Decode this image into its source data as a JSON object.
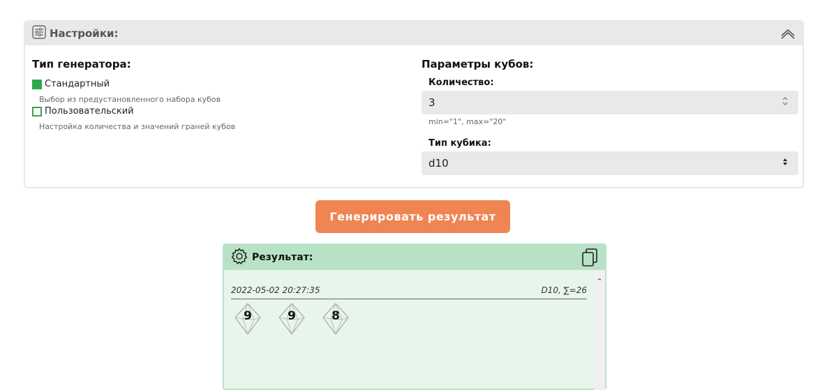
{
  "settings": {
    "title": "Настройки:",
    "generator_type": {
      "heading": "Тип генератора:",
      "options": [
        {
          "label": "Стандартный",
          "description": "Выбор из предустановленного набора кубов",
          "checked": true
        },
        {
          "label": "Пользовательский",
          "description": "Настройка количества и значений граней кубов",
          "checked": false
        }
      ]
    },
    "dice_params": {
      "heading": "Параметры кубов:",
      "count_label": "Количество:",
      "count_value": "3",
      "count_hint": "min=\"1\", max=\"20\"",
      "type_label": "Тип кубика:",
      "type_value": "d10"
    }
  },
  "generate_button": "Генерировать результат",
  "result": {
    "title": "Результат:",
    "timestamp": "2022-05-02 20:27:35",
    "summary": "D10, ∑=26",
    "dice": [
      "9",
      "9",
      "8"
    ]
  },
  "colors": {
    "accent_green": "#2fa84f",
    "button_orange": "#f08553",
    "result_header": "#b8e2c6",
    "result_bg": "#e8f5ea"
  }
}
